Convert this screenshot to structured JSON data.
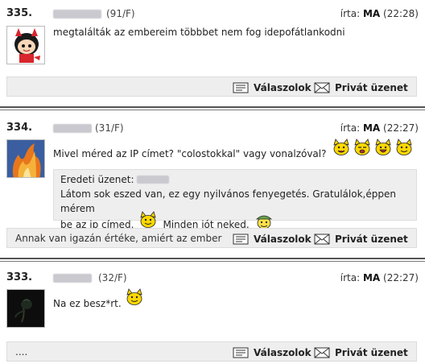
{
  "posts": [
    {
      "number": "335.",
      "meta": "(91/F)",
      "written_label": "írta:",
      "day": "MA",
      "time": "(22:28)",
      "message": "megtalálták az embereim több­bet nem fog idepofátlankodni",
      "signature": ""
    },
    {
      "number": "334.",
      "meta": "(31/F)",
      "written_label": "írta:",
      "day": "MA",
      "time": "(22:27)",
      "message": "Mivel méred az IP címet? \"colostokkal\" vagy vonalzóval?",
      "quote_title": "Eredeti üzenet:",
      "quote_line1": "Látom sok eszed van, ez egy nyilvános fenyegetés. Gratulálok,éppen mérem",
      "quote_line2a": "be az ip címed.",
      "quote_line2b": "Minden jót neked.",
      "signature": "Annak van igazán értéke, amiért az ember"
    },
    {
      "number": "333.",
      "meta": "(32/F)",
      "written_label": "írta:",
      "day": "MA",
      "time": "(22:27)",
      "message": "Na ez besz*rt.",
      "signature": "...."
    }
  ],
  "actions": {
    "reply_label": "Válaszolok",
    "private_label": "Privát üzenet"
  },
  "icons": {
    "reply": "reply-icon",
    "private": "envelope-icon",
    "smiley": "smiley-dog-icon"
  },
  "colors": {
    "bar_bg": "#eeeeee",
    "divider": "#555555",
    "smiley_yellow": "#ffd800"
  }
}
